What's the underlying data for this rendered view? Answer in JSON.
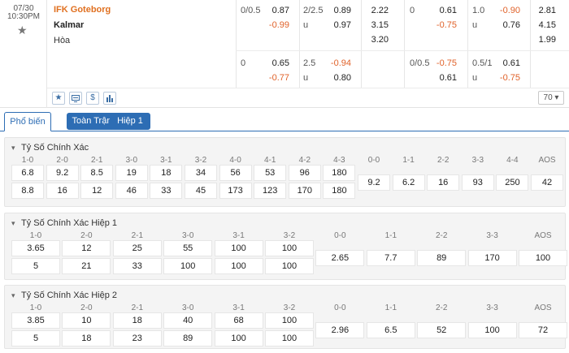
{
  "match": {
    "date": "07/30",
    "time": "10:30PM",
    "home": "IFK Goteborg",
    "away": "Kalmar",
    "draw": "Hòa"
  },
  "odds": {
    "ft_hcp": {
      "line": "0/0.5",
      "home": "0.87",
      "away": "-0.99"
    },
    "ft_ou": {
      "line": "2/2.5",
      "over": "0.89",
      "under_label": "u",
      "under": "0.97"
    },
    "ft_1x2": {
      "home": "2.22",
      "away": "3.15",
      "draw": "3.20"
    },
    "h1_hcp": {
      "line": "0",
      "home": "0.61",
      "away": "-0.75"
    },
    "h1_ou": {
      "line": "1.0",
      "over": "-0.90",
      "under_label": "u",
      "under": "0.76"
    },
    "h1_1x2": {
      "home": "2.81",
      "away": "4.15",
      "draw": "1.99"
    },
    "ft_hcp2": {
      "line": "0",
      "home": "0.65",
      "away": "-0.77"
    },
    "ft_ou2": {
      "line": "2.5",
      "over": "-0.94",
      "under_label": "u",
      "under": "0.80"
    },
    "h1_hcp2": {
      "line": "0/0.5",
      "home": "-0.75",
      "away": "0.61"
    },
    "h1_ou2": {
      "line": "0.5/1",
      "over": "0.61",
      "under_label": "u",
      "under": "-0.75"
    }
  },
  "toolbar": {
    "icons": [
      "star-icon",
      "tv-icon",
      "dollar-icon",
      "stats-icon"
    ],
    "dollar_glyph": "$",
    "count": "70"
  },
  "tabs": [
    "Phổ biến",
    "Toàn Trận",
    "Hiệp 1"
  ],
  "markets": [
    {
      "title": "Tỷ Số Chính Xác",
      "home_scores": [
        "1-0",
        "2-0",
        "2-1",
        "3-0",
        "3-1",
        "3-2",
        "4-0",
        "4-1",
        "4-2",
        "4-3"
      ],
      "home_odds": [
        "6.8",
        "9.2",
        "8.5",
        "19",
        "18",
        "34",
        "56",
        "53",
        "96",
        "180"
      ],
      "away_odds": [
        "8.8",
        "16",
        "12",
        "46",
        "33",
        "45",
        "173",
        "123",
        "170",
        "180"
      ],
      "draw_scores": [
        "0-0",
        "1-1",
        "2-2",
        "3-3",
        "4-4",
        "AOS"
      ],
      "draw_odds": [
        "9.2",
        "6.2",
        "16",
        "93",
        "250",
        "42"
      ]
    },
    {
      "title": "Tỷ Số Chính Xác Hiệp 1",
      "home_scores": [
        "1-0",
        "2-0",
        "2-1",
        "3-0",
        "3-1",
        "3-2"
      ],
      "home_odds": [
        "3.65",
        "12",
        "25",
        "55",
        "100",
        "100"
      ],
      "away_odds": [
        "5",
        "21",
        "33",
        "100",
        "100",
        "100"
      ],
      "draw_scores": [
        "0-0",
        "1-1",
        "2-2",
        "3-3",
        "AOS"
      ],
      "draw_odds": [
        "2.65",
        "7.7",
        "89",
        "170",
        "100"
      ]
    },
    {
      "title": "Tỷ Số Chính Xác Hiệp 2",
      "home_scores": [
        "1-0",
        "2-0",
        "2-1",
        "3-0",
        "3-1",
        "3-2"
      ],
      "home_odds": [
        "3.85",
        "10",
        "18",
        "40",
        "68",
        "100"
      ],
      "away_odds": [
        "5",
        "18",
        "23",
        "89",
        "100",
        "100"
      ],
      "draw_scores": [
        "0-0",
        "1-1",
        "2-2",
        "3-3",
        "AOS"
      ],
      "draw_odds": [
        "2.96",
        "6.5",
        "52",
        "100",
        "72"
      ]
    }
  ]
}
